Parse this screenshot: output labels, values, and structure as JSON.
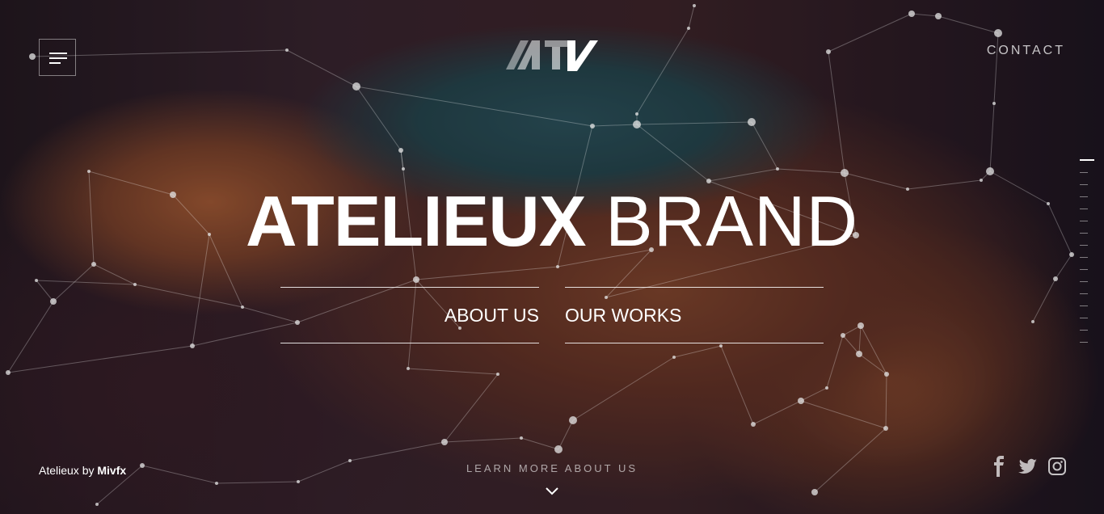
{
  "header": {
    "contact_label": "CONTACT"
  },
  "hero": {
    "title_bold": "ATELIEUX",
    "title_light": "BRAND"
  },
  "nav": {
    "about_label": "ABOUT US",
    "works_label": "OUR WORKS"
  },
  "footer": {
    "credit_prefix": "Atelieux by",
    "credit_author": "Mivfx",
    "learn_more": "LEARN MORE ABOUT US"
  },
  "icons": {
    "menu": "hamburger-icon",
    "logo": "atv-logo",
    "scroll": "chevron-down-icon",
    "social": [
      "facebook-icon",
      "twitter-icon",
      "instagram-icon"
    ]
  },
  "colors": {
    "text": "#ffffff",
    "muted": "#bfbfbf",
    "sky": "#2c5862",
    "rock": "#8c4a2e"
  }
}
